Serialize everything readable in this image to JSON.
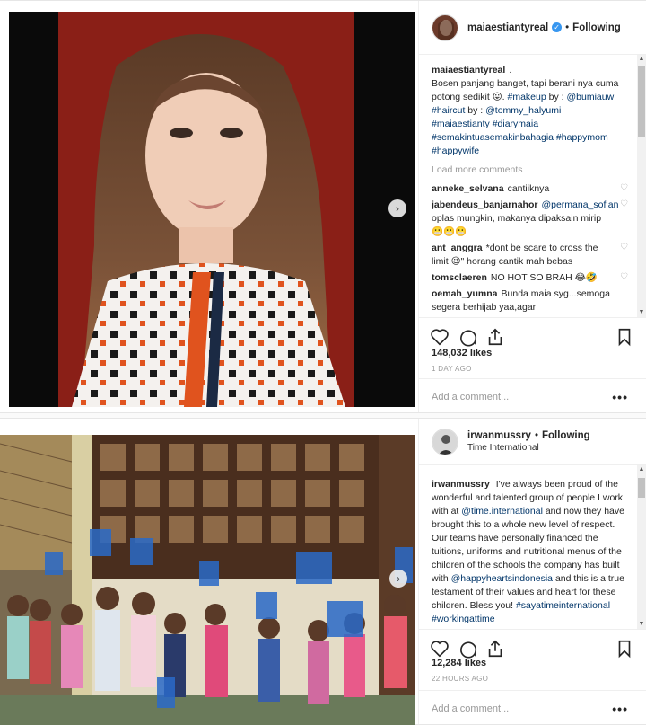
{
  "post1": {
    "username": "maiaestiantyreal",
    "following": "Following",
    "caption_user": "maiaestiantyreal",
    "caption_dot": ".",
    "caption_text": "Bosen panjang banget, tapi berani nya cuma potong sedikit 😛.",
    "caption_tag1": "#makeup",
    "caption_by": "by :",
    "caption_mention1": "@bumiauw",
    "caption_tag2": "#haircut",
    "caption_by2": "by :",
    "caption_mention2": "@tommy_halyumi",
    "caption_tags": "#maiaestianty #diarymaia #semakintuasemakinbahagia #happymom #happywife",
    "load_more": "Load more comments",
    "comments": [
      {
        "user": "anneke_selvana",
        "text": "cantiiknya",
        "mention": ""
      },
      {
        "user": "jabendeus_banjarnahor",
        "mention": "@permana_sofian",
        "text": "oplas mungkin, makanya dipaksain mirip😬😬😬"
      },
      {
        "user": "ant_anggra",
        "text": "*dont be scare to cross the limit 😉\" horang cantik mah bebas",
        "mention": ""
      },
      {
        "user": "tomsclaeren",
        "text": "NO HOT SO BRAH 😂🤣",
        "mention": ""
      },
      {
        "user": "oemah_yumna",
        "text": "Bunda maia syg...semoga segera berhijab yaa,agar",
        "mention": ""
      }
    ],
    "likes": "148,032 likes",
    "time": "1 DAY AGO",
    "add_comment_placeholder": "Add a comment...",
    "more": "•••"
  },
  "post2": {
    "username": "irwanmussry",
    "following": "Following",
    "location": "Time International",
    "caption_user": "irwanmussry",
    "caption_p1": "I've always been proud of the wonderful and talented group of people I work with at",
    "caption_mention1": "@time.international",
    "caption_p2": "and now they have brought this to a whole new level of respect. Our teams have personally financed the tuitions, uniforms and nutritional menus of the children of the schools the company has built with",
    "caption_mention2": "@happyheartsindonesia",
    "caption_p3": "and this is a true testament of their values and heart for these children. Bless you!",
    "caption_tags": "#sayatimeinternational #workingattime",
    "likes": "12,284 likes",
    "time": "22 HOURS AGO",
    "add_comment_placeholder": "Add a comment...",
    "more": "•••"
  },
  "icons": {
    "next": "›",
    "heart": "♡",
    "verified": "✓",
    "up": "▲",
    "down": "▼",
    "dot": "•"
  }
}
